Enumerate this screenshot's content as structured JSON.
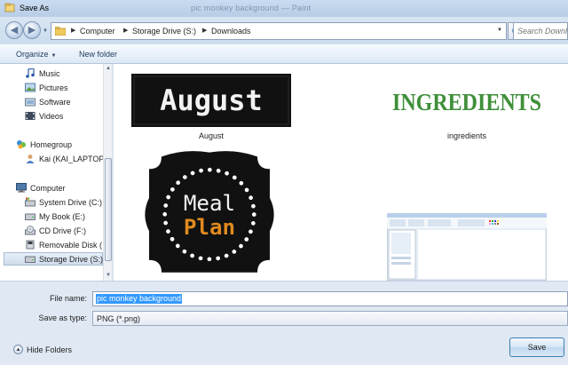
{
  "window": {
    "title": "Save As",
    "ghost_title": "pic monkey background — Paint"
  },
  "address": {
    "crumbs": [
      "Computer",
      "Storage Drive (S:)",
      "Downloads"
    ],
    "search_placeholder": "Search Downlo"
  },
  "toolbar": {
    "organize": "Organize",
    "new_folder": "New folder"
  },
  "nav": {
    "items": [
      {
        "label": "Music"
      },
      {
        "label": "Pictures"
      },
      {
        "label": "Software"
      },
      {
        "label": "Videos"
      },
      {
        "label": "Homegroup"
      },
      {
        "label": "Kai (KAI_LAPTOP"
      },
      {
        "label": "Computer"
      },
      {
        "label": "System Drive (C:)"
      },
      {
        "label": "My Book (E:)"
      },
      {
        "label": "CD Drive (F:)"
      },
      {
        "label": "Removable Disk ("
      },
      {
        "label": "Storage Drive (S:)"
      }
    ]
  },
  "files": [
    {
      "name": "August",
      "thumb_text": "August"
    },
    {
      "name": "ingredients",
      "thumb_text": "INGREDIENTS"
    },
    {
      "name": "",
      "thumb_text_1": "Meal",
      "thumb_text_2": "Plan"
    },
    {
      "name": ""
    }
  ],
  "form": {
    "file_name_label": "File name:",
    "file_name_value": "pic monkey background",
    "save_type_label": "Save as type:",
    "save_type_value": "PNG (*.png)"
  },
  "footer": {
    "hide_folders": "Hide Folders",
    "save": "Save"
  },
  "colors": {
    "accent": "#3399ff",
    "ingredients_green": "#3f8f3a",
    "plan_orange": "#e08a1e"
  }
}
